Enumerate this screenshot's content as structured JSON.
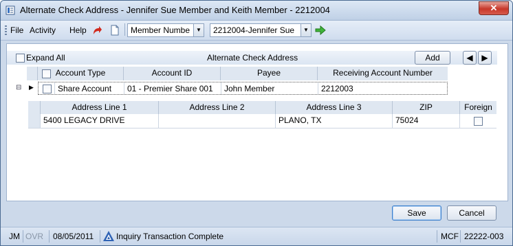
{
  "window": {
    "title": "Alternate Check Address - Jennifer Sue Member and Keith Member - 2212004",
    "close_glyph": "✕"
  },
  "menu": {
    "file": "File",
    "activity": "Activity",
    "help": "Help"
  },
  "toolbar": {
    "search_type": "Member Numbe",
    "member": "2212004-Jennifer Sue"
  },
  "panel": {
    "expand_all": "Expand All",
    "title": "Alternate Check Address",
    "add_label": "Add"
  },
  "grid": {
    "columns": [
      "Account Type",
      "Account ID",
      "Payee",
      "Receiving Account Number"
    ],
    "row": {
      "account_type": "Share Account",
      "account_id": "01 - Premier Share 001",
      "payee": "John Member",
      "receiving_account": "2212003"
    },
    "address_columns": [
      "Address Line 1",
      "Address Line 2",
      "Address Line 3",
      "ZIP",
      "Foreign"
    ],
    "address_row": {
      "line1": "5400 LEGACY DRIVE",
      "line2": "",
      "line3": "PLANO, TX",
      "zip": "75024"
    }
  },
  "buttons": {
    "save": "Save",
    "cancel": "Cancel"
  },
  "status": {
    "user": "JM",
    "ovr": "OVR",
    "date": "08/05/2011",
    "message": "Inquiry Transaction Complete",
    "mode": "MCF",
    "code": "22222-003"
  }
}
